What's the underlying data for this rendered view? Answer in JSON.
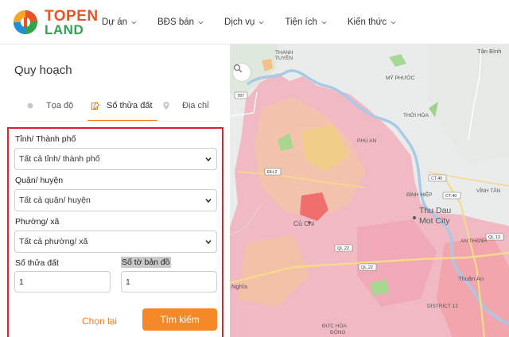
{
  "brand": {
    "line1": "TOPEN",
    "line2": "LAND",
    "accent": "#e8532a",
    "green": "#2ea44f"
  },
  "nav": [
    {
      "label": "Dự án"
    },
    {
      "label": "BĐS bán"
    },
    {
      "label": "Dịch vụ"
    },
    {
      "label": "Tiện ích"
    },
    {
      "label": "Kiến thức"
    }
  ],
  "panel": {
    "title": "Quy hoạch",
    "tabs": [
      {
        "label": "Tọa độ",
        "icon": "dot-icon",
        "active": false
      },
      {
        "label": "Số thửa đất",
        "icon": "land-plot-icon",
        "active": true
      },
      {
        "label": "Địa chỉ",
        "icon": "location-pin-icon",
        "active": false
      }
    ],
    "form": {
      "province": {
        "label": "Tỉnh/ Thành phố",
        "value": "Tất cả tỉnh/ thành phố"
      },
      "district": {
        "label": "Quận/ huyện",
        "value": "Tất cả quận/ huyện"
      },
      "ward": {
        "label": "Phường/ xã",
        "value": "Tất cả phường/ xã"
      },
      "parcel_no": {
        "label": "Số thửa đất",
        "value": "1"
      },
      "sheet_no": {
        "label": "Số tờ bản đồ",
        "value": "1"
      }
    },
    "reset_label": "Chọn lại",
    "search_label": "Tìm kiếm",
    "highlight_color": "#e3202a",
    "action_color": "#f5892a"
  },
  "map": {
    "labels": {
      "thanh_tuyen": "THANH\nTUYỀN",
      "tan_binh": "Tân Bình",
      "my_phuoc": "MỸ PHƯỚC",
      "thoi_hoa": "THỚI HÒA",
      "phu_an": "PHÚ AN",
      "binh_hiep": "BÌNH HIỆP",
      "vinh_tan": "VĨNH TÂN",
      "cu_chi": "Củ Chi",
      "thu_dau": "Thu Dau",
      "mot_city": "Mot City",
      "an_thanh": "AN THẠNH",
      "nghia": "Nghĩa",
      "thuan_an": "Thuận An",
      "district12": "DISTRICT 12",
      "duc_hoa": "ĐỨC HÒA",
      "dong": "ĐÔNG"
    },
    "roads": {
      "r787": "787",
      "dh2": "ĐH.2",
      "ct40a": "CT.40",
      "ct40b": "CT.40",
      "ql22a": "QL.22",
      "ql22b": "QL.22",
      "ql13": "QL.13"
    }
  }
}
